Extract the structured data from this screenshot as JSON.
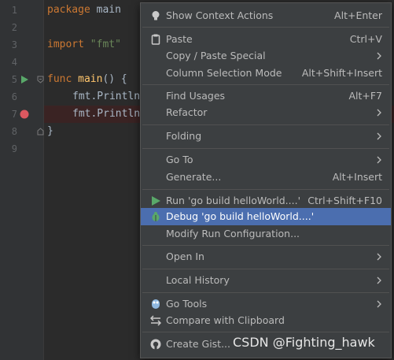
{
  "editor": {
    "line_numbers": [
      "1",
      "2",
      "3",
      "4",
      "5",
      "6",
      "7",
      "8",
      "9"
    ],
    "code": {
      "line1_kw": "package",
      "line1_rest": " main",
      "line3_kw": "import",
      "line3_str": "\"fmt\"",
      "line5_kw": "func",
      "line5_name": "main",
      "line5_rest": "() {",
      "line6": "fmt.Println",
      "line7": "fmt.Println",
      "line8": "}"
    },
    "colors": {
      "background": "#2b2b2b",
      "gutter": "#313335",
      "keyword": "#cc7832",
      "string": "#6a8759",
      "breakpoint": "#db5860",
      "run_arrow": "#59a869"
    }
  },
  "menu": {
    "items": [
      {
        "label": "Show Context Actions",
        "shortcut": "Alt+Enter",
        "icon": "bulb-icon"
      },
      {
        "label": "Paste",
        "shortcut": "Ctrl+V",
        "icon": "clipboard-icon"
      },
      {
        "label": "Copy / Paste Special",
        "submenu": true
      },
      {
        "label": "Column Selection Mode",
        "shortcut": "Alt+Shift+Insert"
      },
      {
        "label": "Find Usages",
        "shortcut": "Alt+F7"
      },
      {
        "label": "Refactor",
        "submenu": true
      },
      {
        "label": "Folding",
        "submenu": true
      },
      {
        "label": "Go To",
        "submenu": true
      },
      {
        "label": "Generate...",
        "shortcut": "Alt+Insert"
      },
      {
        "label": "Run 'go build helloWorld....'",
        "shortcut": "Ctrl+Shift+F10",
        "icon": "run-icon"
      },
      {
        "label": "Debug 'go build helloWorld....'",
        "icon": "debug-icon",
        "selected": true
      },
      {
        "label": "Modify Run Configuration..."
      },
      {
        "label": "Open In",
        "submenu": true
      },
      {
        "label": "Local History",
        "submenu": true
      },
      {
        "label": "Go Tools",
        "submenu": true,
        "icon": "go-tools-icon"
      },
      {
        "label": "Compare with Clipboard",
        "icon": "compare-icon"
      },
      {
        "label": "Create Gist...",
        "icon": "github-icon"
      }
    ],
    "colors": {
      "background": "#3c3f41",
      "selection": "#4b6eaf",
      "text": "#bbbbbb"
    }
  },
  "watermark": "CSDN @Fighting_hawk"
}
